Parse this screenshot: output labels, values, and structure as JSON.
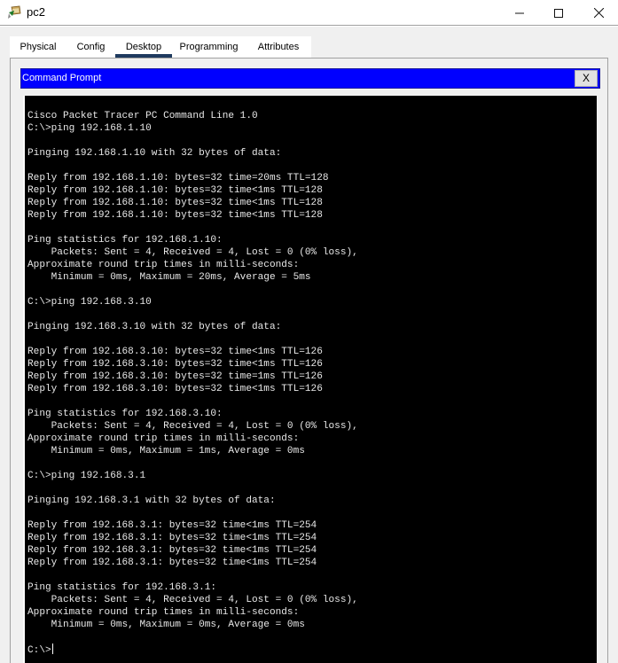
{
  "window": {
    "title": "pc2",
    "icon": "packet-tracer-pc-icon",
    "controls": {
      "minimize": "minimize-icon",
      "maximize": "maximize-icon",
      "close": "close-icon"
    }
  },
  "tabs": [
    {
      "label": "Physical",
      "active": false
    },
    {
      "label": "Config",
      "active": false
    },
    {
      "label": "Desktop",
      "active": true
    },
    {
      "label": "Programming",
      "active": false
    },
    {
      "label": "Attributes",
      "active": false
    }
  ],
  "command_prompt": {
    "title": "Command Prompt",
    "close_label": "X",
    "prompt": "C:\\>",
    "lines": [
      "Cisco Packet Tracer PC Command Line 1.0",
      "C:\\>ping 192.168.1.10",
      "",
      "Pinging 192.168.1.10 with 32 bytes of data:",
      "",
      "Reply from 192.168.1.10: bytes=32 time=20ms TTL=128",
      "Reply from 192.168.1.10: bytes=32 time<1ms TTL=128",
      "Reply from 192.168.1.10: bytes=32 time<1ms TTL=128",
      "Reply from 192.168.1.10: bytes=32 time<1ms TTL=128",
      "",
      "Ping statistics for 192.168.1.10:",
      "    Packets: Sent = 4, Received = 4, Lost = 0 (0% loss),",
      "Approximate round trip times in milli-seconds:",
      "    Minimum = 0ms, Maximum = 20ms, Average = 5ms",
      "",
      "C:\\>ping 192.168.3.10",
      "",
      "Pinging 192.168.3.10 with 32 bytes of data:",
      "",
      "Reply from 192.168.3.10: bytes=32 time<1ms TTL=126",
      "Reply from 192.168.3.10: bytes=32 time<1ms TTL=126",
      "Reply from 192.168.3.10: bytes=32 time=1ms TTL=126",
      "Reply from 192.168.3.10: bytes=32 time<1ms TTL=126",
      "",
      "Ping statistics for 192.168.3.10:",
      "    Packets: Sent = 4, Received = 4, Lost = 0 (0% loss),",
      "Approximate round trip times in milli-seconds:",
      "    Minimum = 0ms, Maximum = 1ms, Average = 0ms",
      "",
      "C:\\>ping 192.168.3.1",
      "",
      "Pinging 192.168.3.1 with 32 bytes of data:",
      "",
      "Reply from 192.168.3.1: bytes=32 time<1ms TTL=254",
      "Reply from 192.168.3.1: bytes=32 time<1ms TTL=254",
      "Reply from 192.168.3.1: bytes=32 time<1ms TTL=254",
      "Reply from 192.168.3.1: bytes=32 time<1ms TTL=254",
      "",
      "Ping statistics for 192.168.3.1:",
      "    Packets: Sent = 4, Received = 4, Lost = 0 (0% loss),",
      "Approximate round trip times in milli-seconds:",
      "    Minimum = 0ms, Maximum = 0ms, Average = 0ms",
      ""
    ]
  },
  "colors": {
    "cp_titlebar": "#0000ff",
    "terminal_bg": "#000000",
    "terminal_text": "#e8e8e8",
    "active_tab_indicator": "#1e3a5f"
  }
}
